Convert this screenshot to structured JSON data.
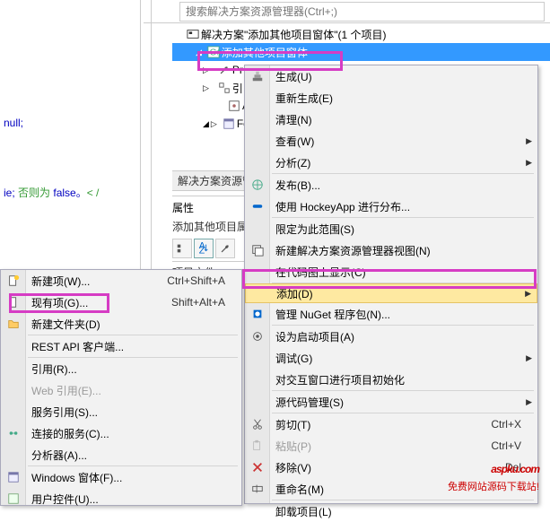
{
  "search": {
    "placeholder": "搜索解决方案资源管理器(Ctrl+;)"
  },
  "explorer": {
    "solution": "解决方案\"添加其他项目窗体\"(1 个项目)",
    "project": "添加其他项目窗体",
    "items": {
      "pr": "Pr",
      "bl": "引",
      "ap": "Ap",
      "fo": "Fo"
    },
    "section_label": "解决方案资源管"
  },
  "props": {
    "header": "属性",
    "sub": "添加其他项目属",
    "row": "项目文件"
  },
  "code": {
    "l1": "null;",
    "l2a": "ie;",
    "l2b": " 否则为 ",
    "l2c": "false。",
    "l2d": "< /"
  },
  "menu_right": {
    "build": "生成(U)",
    "rebuild": "重新生成(E)",
    "clean": "清理(N)",
    "view": "查看(W)",
    "analyze": "分析(Z)",
    "publish": "发布(B)...",
    "hockey": "使用 HockeyApp 进行分布...",
    "scope": "限定为此范围(S)",
    "newview": "新建解决方案资源管理器视图(N)",
    "codemap": "在代码图上显示(C)",
    "add": "添加(D)",
    "nuget": "管理 NuGet 程序包(N)...",
    "startup": "设为启动项目(A)",
    "debug": "调试(G)",
    "interactive": "对交互窗口进行项目初始化",
    "source": "源代码管理(S)",
    "cut": "剪切(T)",
    "cut_sc": "Ctrl+X",
    "paste": "粘贴(P)",
    "paste_sc": "Ctrl+V",
    "remove": "移除(V)",
    "remove_sc": "Del",
    "rename": "重命名(M)",
    "unload": "卸载项目(L)"
  },
  "menu_left": {
    "newitem": "新建项(W)...",
    "newitem_sc": "Ctrl+Shift+A",
    "existing": "现有项(G)...",
    "existing_sc": "Shift+Alt+A",
    "newfolder": "新建文件夹(D)",
    "rest": "REST API 客户端...",
    "reference": "引用(R)...",
    "webref": "Web 引用(E)...",
    "svcref": "服务引用(S)...",
    "connsvc": "连接的服务(C)...",
    "analyzer": "分析器(A)...",
    "winform": "Windows 窗体(F)...",
    "userctrl": "用户控件(U)..."
  },
  "watermark": {
    "logo": "aspku",
    "com": ".com",
    "sub": "免费网站源码下载站!"
  }
}
